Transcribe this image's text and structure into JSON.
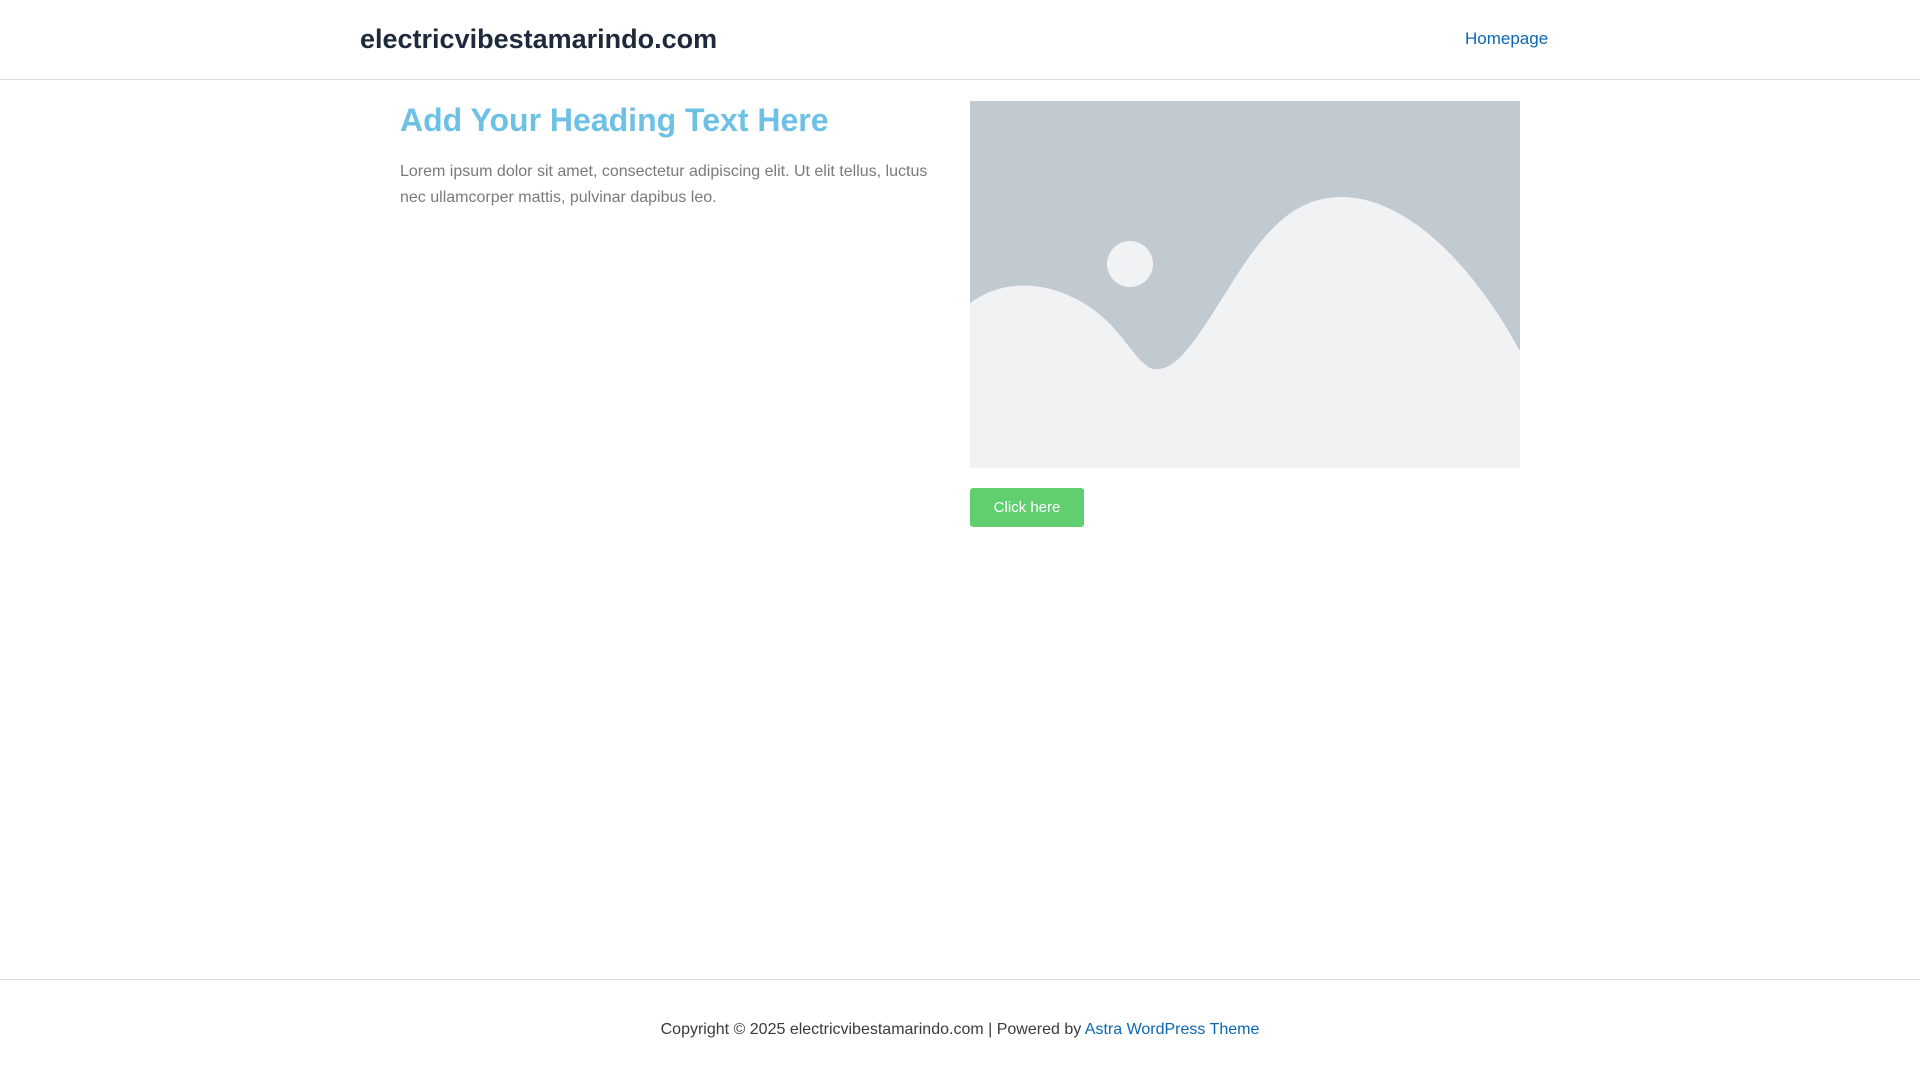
{
  "header": {
    "site_title": "electricvibestamarindo.com",
    "nav": {
      "homepage_label": "Homepage"
    }
  },
  "main": {
    "heading": "Add Your Heading Text Here",
    "body_text": "Lorem ipsum dolor sit amet, consectetur adipiscing elit. Ut elit tellus, luctus nec ullamcorper mattis, pulvinar dapibus leo.",
    "image_icon": "image-placeholder-icon",
    "button_label": "Click here"
  },
  "footer": {
    "copyright_text": "Copyright © 2025 electricvibestamarindo.com | Powered by",
    "theme_link_label": "Astra WordPress Theme"
  },
  "colors": {
    "site_title": "#1e2a3b",
    "link": "#0a67b3",
    "heading": "#6ec1e4",
    "body_text": "#7a7a7a",
    "button": "#61ce70",
    "placeholder_bg": "#c1c9d1",
    "placeholder_fg": "#f1f2f3"
  }
}
